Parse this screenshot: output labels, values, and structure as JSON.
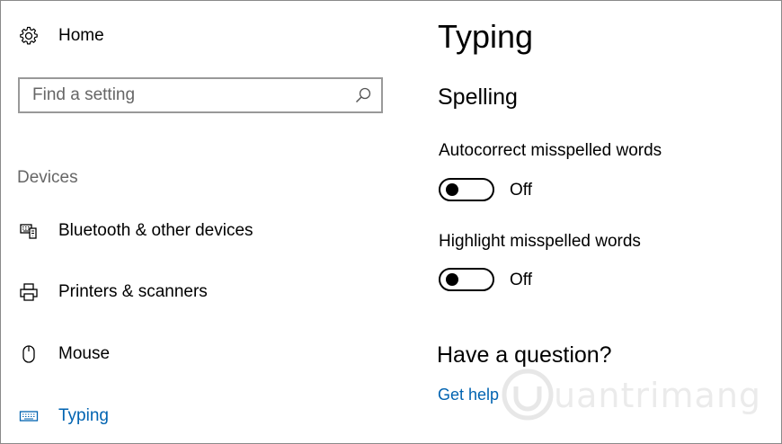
{
  "sidebar": {
    "home_label": "Home",
    "search": {
      "placeholder": "Find a setting"
    },
    "group_header": "Devices",
    "items": [
      {
        "label": "Bluetooth & other devices",
        "icon": "keyboard-device-icon"
      },
      {
        "label": "Printers & scanners",
        "icon": "printer-icon"
      },
      {
        "label": "Mouse",
        "icon": "mouse-icon"
      },
      {
        "label": "Typing",
        "icon": "keyboard-icon",
        "active": true
      }
    ]
  },
  "main": {
    "title": "Typing",
    "section": "Spelling",
    "settings": [
      {
        "label": "Autocorrect misspelled words",
        "state": "Off"
      },
      {
        "label": "Highlight misspelled words",
        "state": "Off"
      }
    ],
    "question": {
      "title": "Have a question?",
      "link": "Get help"
    }
  },
  "watermark": {
    "text": "uantrimang"
  },
  "colors": {
    "accent": "#0063b1",
    "muted": "#666666",
    "border": "#999999"
  }
}
